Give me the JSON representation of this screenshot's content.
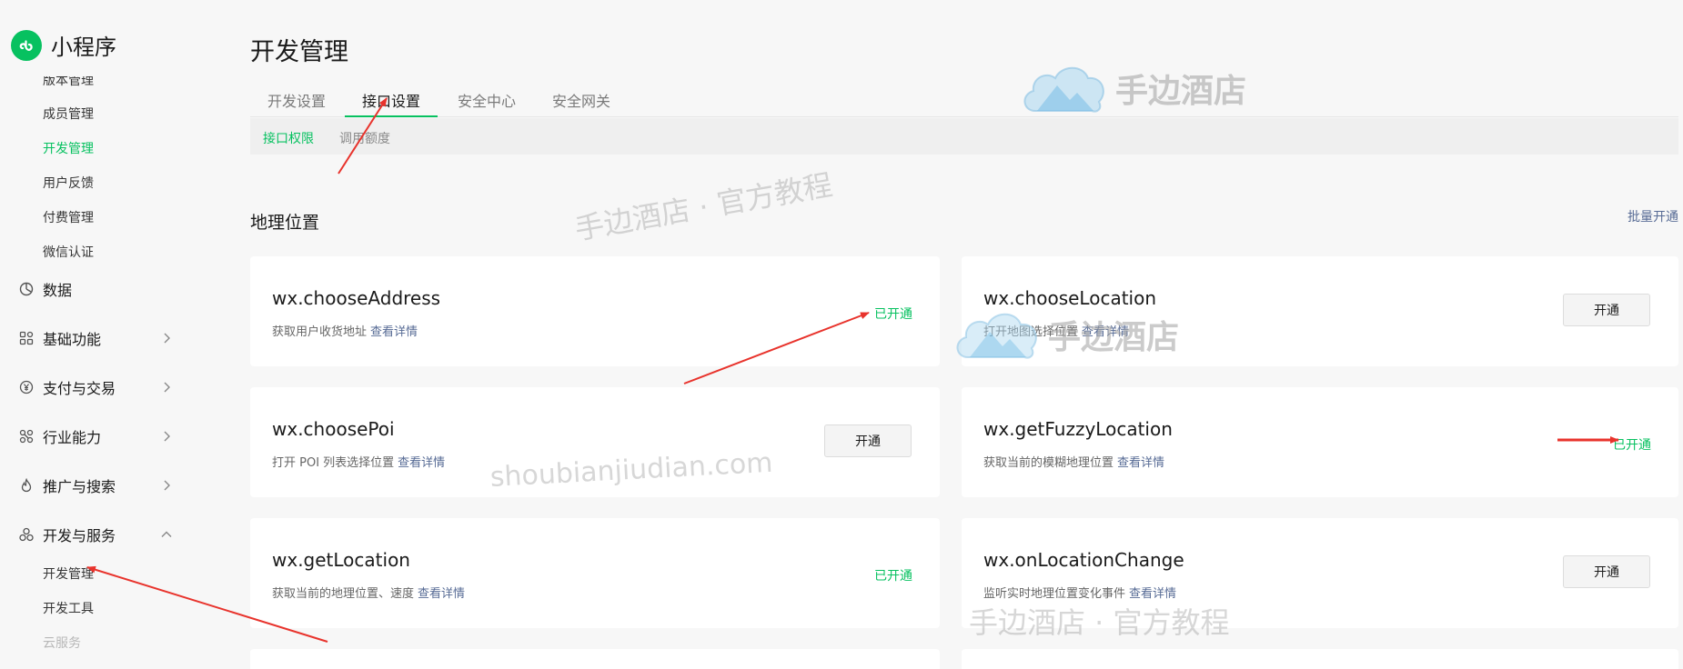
{
  "app": {
    "title": "小程序"
  },
  "sidebar": {
    "top_subitems": [
      {
        "label": "版本管理"
      },
      {
        "label": "成员管理"
      },
      {
        "label": "开发管理"
      },
      {
        "label": "用户反馈"
      },
      {
        "label": "付费管理"
      },
      {
        "label": "微信认证"
      }
    ],
    "nav": [
      {
        "label": "数据",
        "icon": "chart-icon"
      },
      {
        "label": "基础功能",
        "icon": "grid-icon"
      },
      {
        "label": "支付与交易",
        "icon": "yen-icon"
      },
      {
        "label": "行业能力",
        "icon": "nodes-icon"
      },
      {
        "label": "推广与搜索",
        "icon": "flame-icon"
      },
      {
        "label": "开发与服务",
        "icon": "cluster-icon"
      }
    ],
    "dev_subitems": [
      {
        "label": "开发管理"
      },
      {
        "label": "开发工具"
      },
      {
        "label": "云服务"
      }
    ]
  },
  "page": {
    "title": "开发管理"
  },
  "tabs": [
    {
      "label": "开发设置"
    },
    {
      "label": "接口设置"
    },
    {
      "label": "安全中心"
    },
    {
      "label": "安全网关"
    }
  ],
  "subtabs": [
    {
      "label": "接口权限"
    },
    {
      "label": "调用额度"
    }
  ],
  "section": {
    "title": "地理位置",
    "batch_label": "批量开通"
  },
  "cards": [
    {
      "name": "wx.chooseAddress",
      "desc": "获取用户收货地址",
      "link": "查看详情",
      "status": "已开通"
    },
    {
      "name": "wx.chooseLocation",
      "desc": "打开地图选择位置",
      "link": "查看详情",
      "button": "开通"
    },
    {
      "name": "wx.choosePoi",
      "desc": "打开 POI 列表选择位置",
      "link": "查看详情",
      "button": "开通"
    },
    {
      "name": "wx.getFuzzyLocation",
      "desc": "获取当前的模糊地理位置",
      "link": "查看详情",
      "status": "已开通"
    },
    {
      "name": "wx.getLocation",
      "desc": "获取当前的地理位置、速度",
      "link": "查看详情",
      "status": "已开通"
    },
    {
      "name": "wx.onLocationChange",
      "desc": "监听实时地理位置变化事件",
      "link": "查看详情",
      "button": "开通"
    }
  ],
  "watermarks": {
    "brand": "手边酒店",
    "tutorial": "手边酒店 · 官方教程",
    "url": "shoubianjiudian.com"
  },
  "colors": {
    "accent": "#07c160",
    "link": "#576b95",
    "arrow": "#e8332c"
  }
}
